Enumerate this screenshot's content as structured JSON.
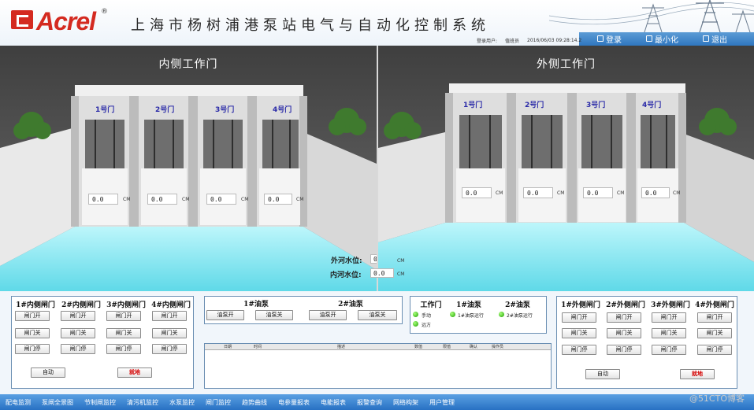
{
  "header": {
    "logo": "Acrel",
    "logo_mark": "®",
    "title": "上海市杨树浦港泵站电气与自动化控制系统",
    "login_user_label": "登录用户:",
    "login_user": "值班员",
    "datetime": "2016/06/03 09:28:14.2",
    "login_btn": "登录",
    "minimize_btn": "最小化",
    "exit_btn": "退出"
  },
  "inner_scene": {
    "title": "内侧工作门",
    "gates": [
      {
        "label": "1号门",
        "value": "0.0",
        "unit": "CM"
      },
      {
        "label": "2号门",
        "value": "0.0",
        "unit": "CM"
      },
      {
        "label": "3号门",
        "value": "0.0",
        "unit": "CM"
      },
      {
        "label": "4号门",
        "value": "0.0",
        "unit": "CM"
      }
    ],
    "outer_level_label": "外河水位:",
    "outer_level_value": "0.0",
    "inner_level_label": "内河水位:",
    "inner_level_value": "0.0",
    "level_unit": "CM"
  },
  "outer_scene": {
    "title": "外侧工作门",
    "gates": [
      {
        "label": "1号门",
        "value": "0.0",
        "unit": "CM"
      },
      {
        "label": "2号门",
        "value": "0.0",
        "unit": "CM"
      },
      {
        "label": "3号门",
        "value": "0.0",
        "unit": "CM"
      },
      {
        "label": "4号门",
        "value": "0.0",
        "unit": "CM"
      }
    ]
  },
  "inner_controls": {
    "columns": [
      "1#内侧闸门",
      "2#内侧闸门",
      "3#内侧闸门",
      "4#内侧闸门"
    ],
    "open": "闸门开",
    "close": "闸门关",
    "stop": "闸门停",
    "auto": "自动",
    "local": "就地"
  },
  "pumps": {
    "pump1": "1#油泵",
    "pump2": "2#油泵",
    "pump1_start": "油泵开",
    "pump1_stop": "油泵关",
    "pump2_start": "油泵开",
    "pump2_stop": "油泵关"
  },
  "status_panel": {
    "work_gate": "工作门",
    "pump1": "1#油泵",
    "pump2": "2#油泵",
    "manual": "手动",
    "remote": "远方",
    "pump1_run": "1#油泵运行",
    "pump2_run": "2#油泵运行"
  },
  "event_table": {
    "columns": [
      "日期",
      "时间",
      "描述",
      "数值",
      "限值",
      "确认",
      "操作员"
    ]
  },
  "outer_controls": {
    "columns": [
      "1#外侧闸门",
      "2#外侧闸门",
      "3#外侧闸门",
      "4#外侧闸门"
    ],
    "open": "闸门开",
    "close": "闸门关",
    "stop": "闸门停",
    "auto": "自动",
    "local": "就地"
  },
  "navbar": [
    "配电监测",
    "泵闸全景图",
    "节制闸监控",
    "清污机监控",
    "水泵监控",
    "闸门监控",
    "趋势曲线",
    "电参量报表",
    "电能报表",
    "报警查询",
    "网络构架",
    "用户管理"
  ],
  "watermark": "@51CTO博客",
  "colors": {
    "brand": "#d42a20",
    "nav": "#2f77c0",
    "water": "#7ce3ee",
    "led": "#1ea000"
  }
}
